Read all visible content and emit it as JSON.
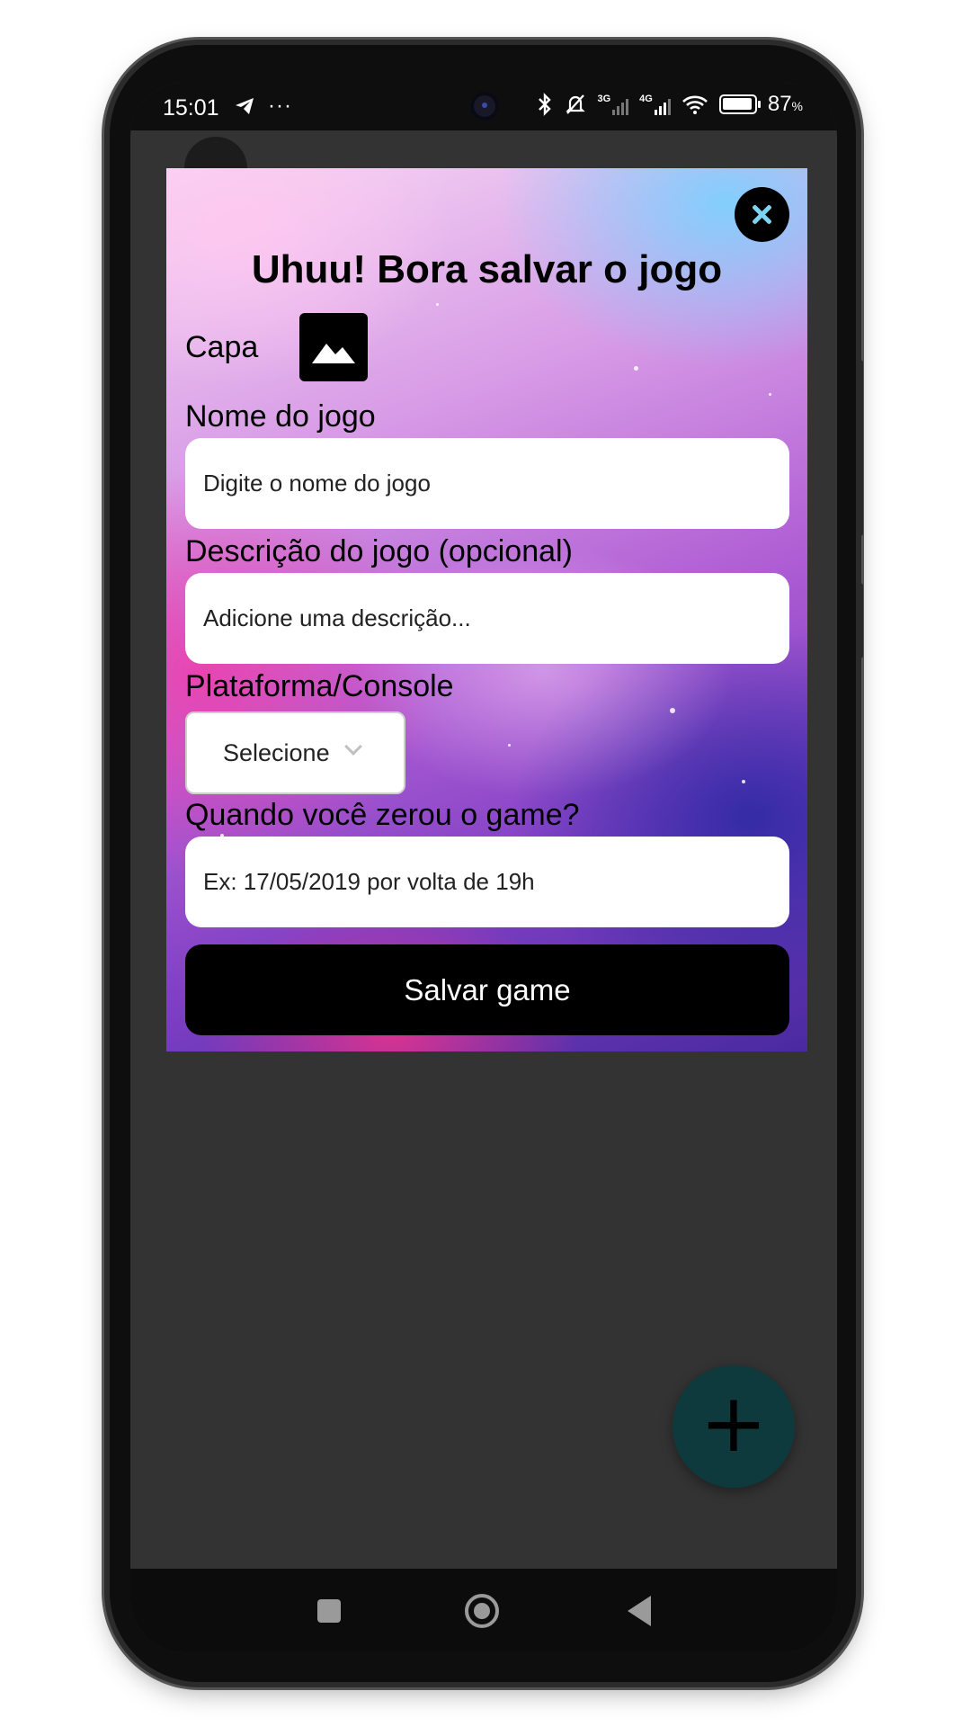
{
  "status_bar": {
    "time": "15:01",
    "battery": "87",
    "battery_unit": "%",
    "network_3g": "3G",
    "network_4g": "4G"
  },
  "modal": {
    "title": "Uhuu! Bora salvar o jogo",
    "cover_label": "Capa",
    "name_label": "Nome do jogo",
    "name_placeholder": "Digite o nome do jogo",
    "description_label": "Descrição do jogo (opcional)",
    "description_placeholder": "Adicione uma descrição...",
    "platform_label": "Plataforma/Console",
    "platform_selected": "Selecione",
    "finished_label": "Quando você zerou o game?",
    "finished_placeholder": "Ex: 17/05/2019 por volta de 19h",
    "save_button": "Salvar game"
  },
  "fab": {
    "icon": "plus-icon",
    "symbol": "+"
  },
  "colors": {
    "screen_bg": "#333333",
    "fab_bg": "#0f3a3d",
    "close_x": "#7fd3f2",
    "button_bg": "#000000"
  }
}
